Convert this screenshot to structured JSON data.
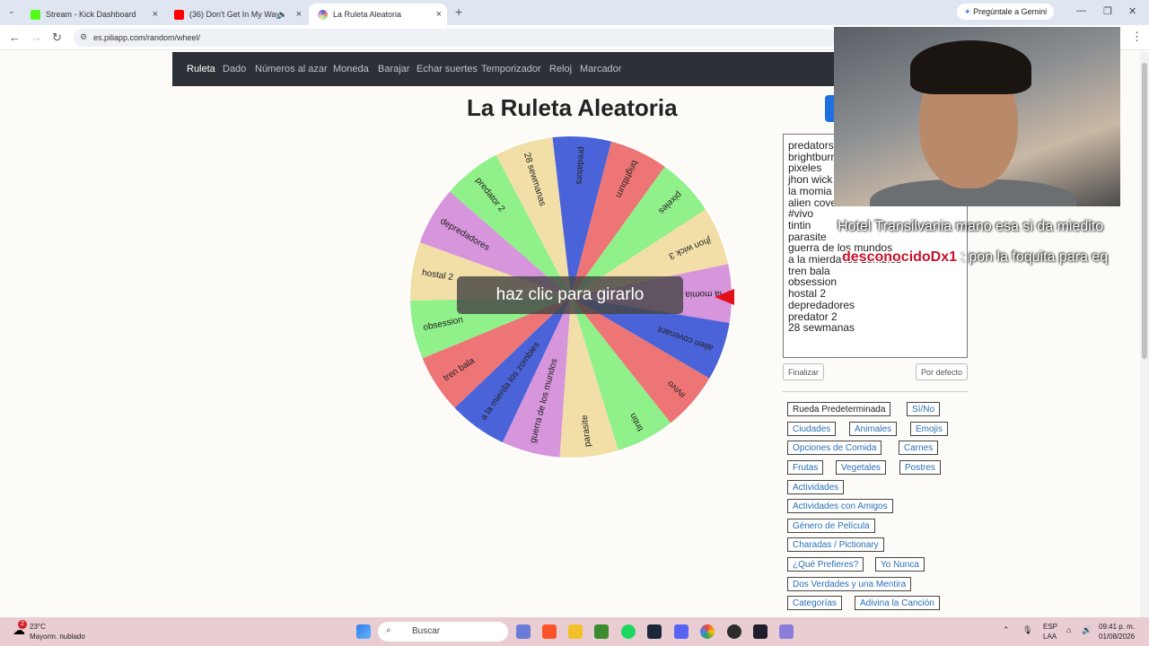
{
  "browser": {
    "tabs": [
      {
        "label": "Stream - Kick Dashboard",
        "color": "#53fc18"
      },
      {
        "label": "(36) Don't Get In My Way -",
        "color": "#ff0000"
      },
      {
        "label": "La Ruleta Aleatoria",
        "color": "#b25bd6"
      }
    ],
    "url": "es.piliapp.com/random/wheel/",
    "gemini_label": "Pregúntale a Gemini"
  },
  "site_nav": {
    "items": [
      "Ruleta",
      "Dado",
      "Números al azar",
      "Moneda",
      "Barajar",
      "Echar suertes",
      "Temporizador",
      "Reloj",
      "Marcador"
    ]
  },
  "page": {
    "title": "La Ruleta Aleatoria",
    "spin_label": "haz clic para girarlo"
  },
  "wheel": {
    "entries": [
      "predators",
      "brightburn",
      "pixeles",
      "jhon wick 3",
      "la momia",
      "alien covenant",
      "#vivo",
      "tintin",
      "parasite",
      "guerra de los mundos",
      "a la mierda los zombies",
      "tren bala",
      "obsession",
      "hostal 2",
      "depredadores",
      "predator 2",
      "28 sewmanas"
    ],
    "colors": [
      "#4a63d8",
      "#ee7575",
      "#90f08a",
      "#f2dfa8",
      "#d795dc",
      "#4a63d8",
      "#ee7575",
      "#90f08a",
      "#f2dfa8",
      "#d795dc",
      "#4a63d8",
      "#ee7575",
      "#90f08a",
      "#f2dfa8",
      "#d795dc",
      "#90f08a",
      "#f2dfa8"
    ],
    "pointer_color": "#e3101a"
  },
  "editor": {
    "lines": [
      "predators",
      "brightburn",
      "pixeles",
      "jhon wick 3",
      "la momia",
      "alien covenant",
      "#vivo",
      "tintin",
      "parasite",
      "guerra de los mundos",
      "a la mierda los zombies",
      "tren bala",
      "obsession",
      "hostal 2",
      "depredadores",
      "predator 2",
      "28 sewmanas"
    ],
    "finish_label": "Finalizar",
    "default_label": "Por defecto"
  },
  "presets": {
    "items": [
      "Rueda Predeterminada",
      "Sí/No",
      "Ciudades",
      "Animales",
      "Emojis",
      "Opciones de Comida",
      "Carnes",
      "Frutas",
      "Vegetales",
      "Postres",
      "Actividades",
      "Actividades con Amigos",
      "Género de Película",
      "Charadas / Pictionary",
      "¿Qué Prefieres?",
      "Yo Nunca",
      "Dos Verdades y una Mentira",
      "Categorías",
      "Adivina la Canción"
    ]
  },
  "stream_overlay": {
    "chat": [
      {
        "user": "",
        "message": "Hotel Transilvania mano esa si da miedito"
      },
      {
        "user": "desconocidoDx1",
        "message": ": pon la foquita para eq"
      }
    ]
  },
  "taskbar": {
    "weather_temp": "23°C",
    "weather_desc": "Mayorm. nublado",
    "weather_badge": "2",
    "search_label": "Buscar",
    "lang_top": "ESP",
    "lang_bottom": "LAA",
    "time": "09:41 p. m.",
    "date": "01/08/2026"
  }
}
